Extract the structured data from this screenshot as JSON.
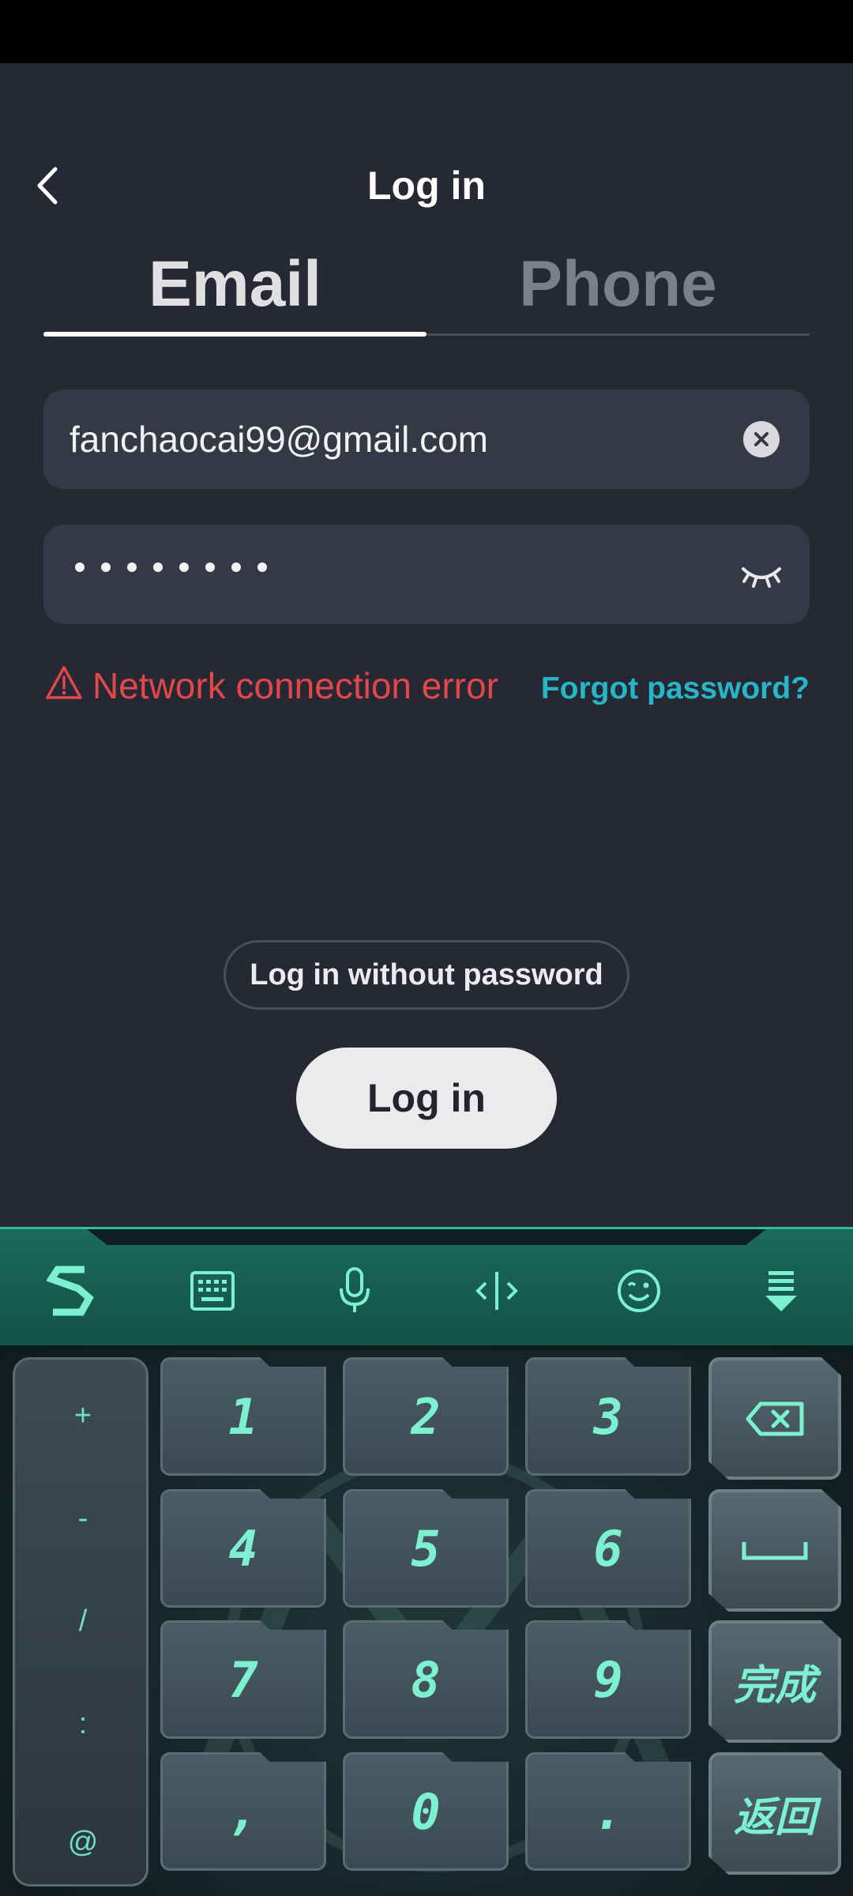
{
  "header": {
    "title": "Log in"
  },
  "tabs": [
    {
      "label": "Email",
      "active": true
    },
    {
      "label": "Phone",
      "active": false
    }
  ],
  "form": {
    "email_value": "fanchaocai99@gmail.com",
    "password_mask_count": 8,
    "error_text": "Network connection error",
    "forgot_label": "Forgot password?"
  },
  "buttons": {
    "without_password": "Log in without password",
    "login": "Log in"
  },
  "keyboard": {
    "toolbar_icons": [
      "logo-icon",
      "keyboard-icon",
      "microphone-icon",
      "cursor-icon",
      "emoji-icon",
      "hide-keyboard-icon"
    ],
    "side_keys": [
      "+",
      "-",
      "/",
      ":",
      "@"
    ],
    "digit_keys": [
      "1",
      "2",
      "3",
      "4",
      "5",
      "6",
      "7",
      "8",
      "9",
      ",",
      "0",
      "."
    ],
    "done_label": "完成",
    "return_label": "返回"
  },
  "colors": {
    "background": "#262833",
    "error": "#e2474b",
    "link": "#27b5c8",
    "keyboard_accent": "#7cf0cf"
  }
}
